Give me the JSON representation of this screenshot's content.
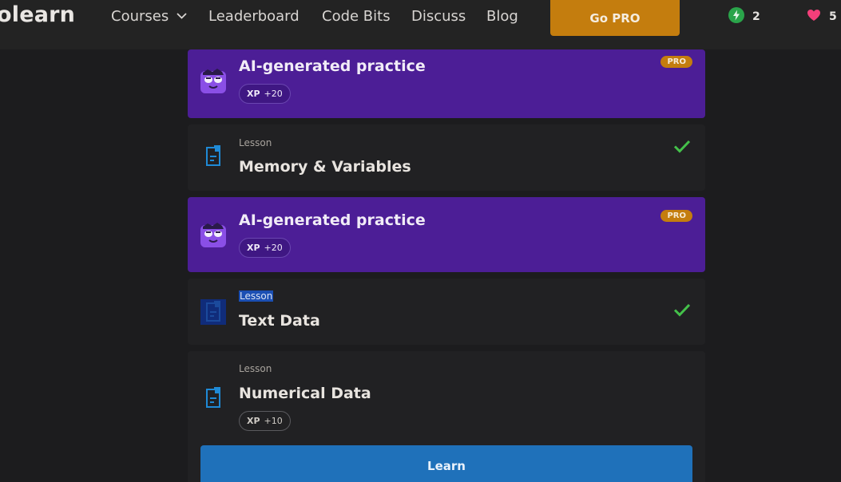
{
  "brand": {
    "logo_text": "olearn"
  },
  "nav": {
    "courses": "Courses",
    "leaderboard": "Leaderboard",
    "code_bits": "Code Bits",
    "discuss": "Discuss",
    "blog": "Blog",
    "go_pro": "Go PRO"
  },
  "stats": {
    "bolt_count": "2",
    "hearts": "5"
  },
  "colors": {
    "accent_pro": "#c47d0e",
    "practice_bg": "#4c1e96",
    "learn_blue": "#1f71ba",
    "check_green": "#44c14a",
    "heart_pink": "#f43f7a",
    "bolt_green": "#2aa44a"
  },
  "items": [
    {
      "type": "practice",
      "title": "AI-generated practice",
      "xp_label": "XP",
      "xp_value": "+20",
      "badge": "PRO",
      "icon": "ai-bot-icon"
    },
    {
      "type": "lesson",
      "kind": "Lesson",
      "title": "Memory & Variables",
      "icon": "document-icon",
      "completed": true
    },
    {
      "type": "practice",
      "title": "AI-generated practice",
      "xp_label": "XP",
      "xp_value": "+20",
      "badge": "PRO",
      "icon": "ai-bot-icon"
    },
    {
      "type": "lesson",
      "kind": "Lesson",
      "title": "Text Data",
      "icon": "document-icon",
      "completed": true
    },
    {
      "type": "lesson",
      "kind": "Lesson",
      "title": "Numerical Data",
      "xp_label": "XP",
      "xp_value": "+10",
      "icon": "document-icon",
      "button": "Learn"
    }
  ]
}
